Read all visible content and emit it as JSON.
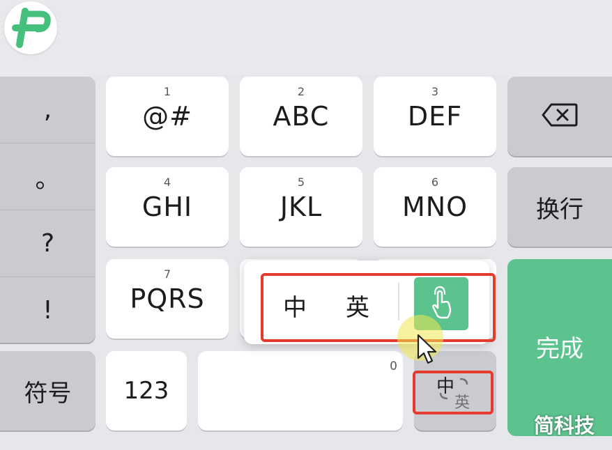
{
  "keyboard": {
    "punctuation": [
      ",",
      "。",
      "?",
      "!"
    ],
    "keys": {
      "k1": {
        "num": "1",
        "label": "@#"
      },
      "k2": {
        "num": "2",
        "label": "ABC"
      },
      "k3": {
        "num": "3",
        "label": "DEF"
      },
      "k4": {
        "num": "4",
        "label": "GHI"
      },
      "k5": {
        "num": "5",
        "label": "JKL"
      },
      "k6": {
        "num": "6",
        "label": "MNO"
      },
      "k7": {
        "num": "7",
        "label": "PQRS"
      }
    },
    "newline_label": "换行",
    "done_label": "完成",
    "symbols_label": "符号",
    "numbers_label": "123",
    "space_num": "0",
    "lang_switch": {
      "primary": "中",
      "secondary": "英"
    }
  },
  "popup": {
    "chinese": "中",
    "english": "英",
    "handwriting_icon": "hand-pointer-icon"
  },
  "logo_icon": "app-logo-icon",
  "backspace_icon": "backspace-icon",
  "watermark": "简科技",
  "colors": {
    "accent_green": "#5cc28e",
    "highlight_red": "#e53a2e"
  }
}
